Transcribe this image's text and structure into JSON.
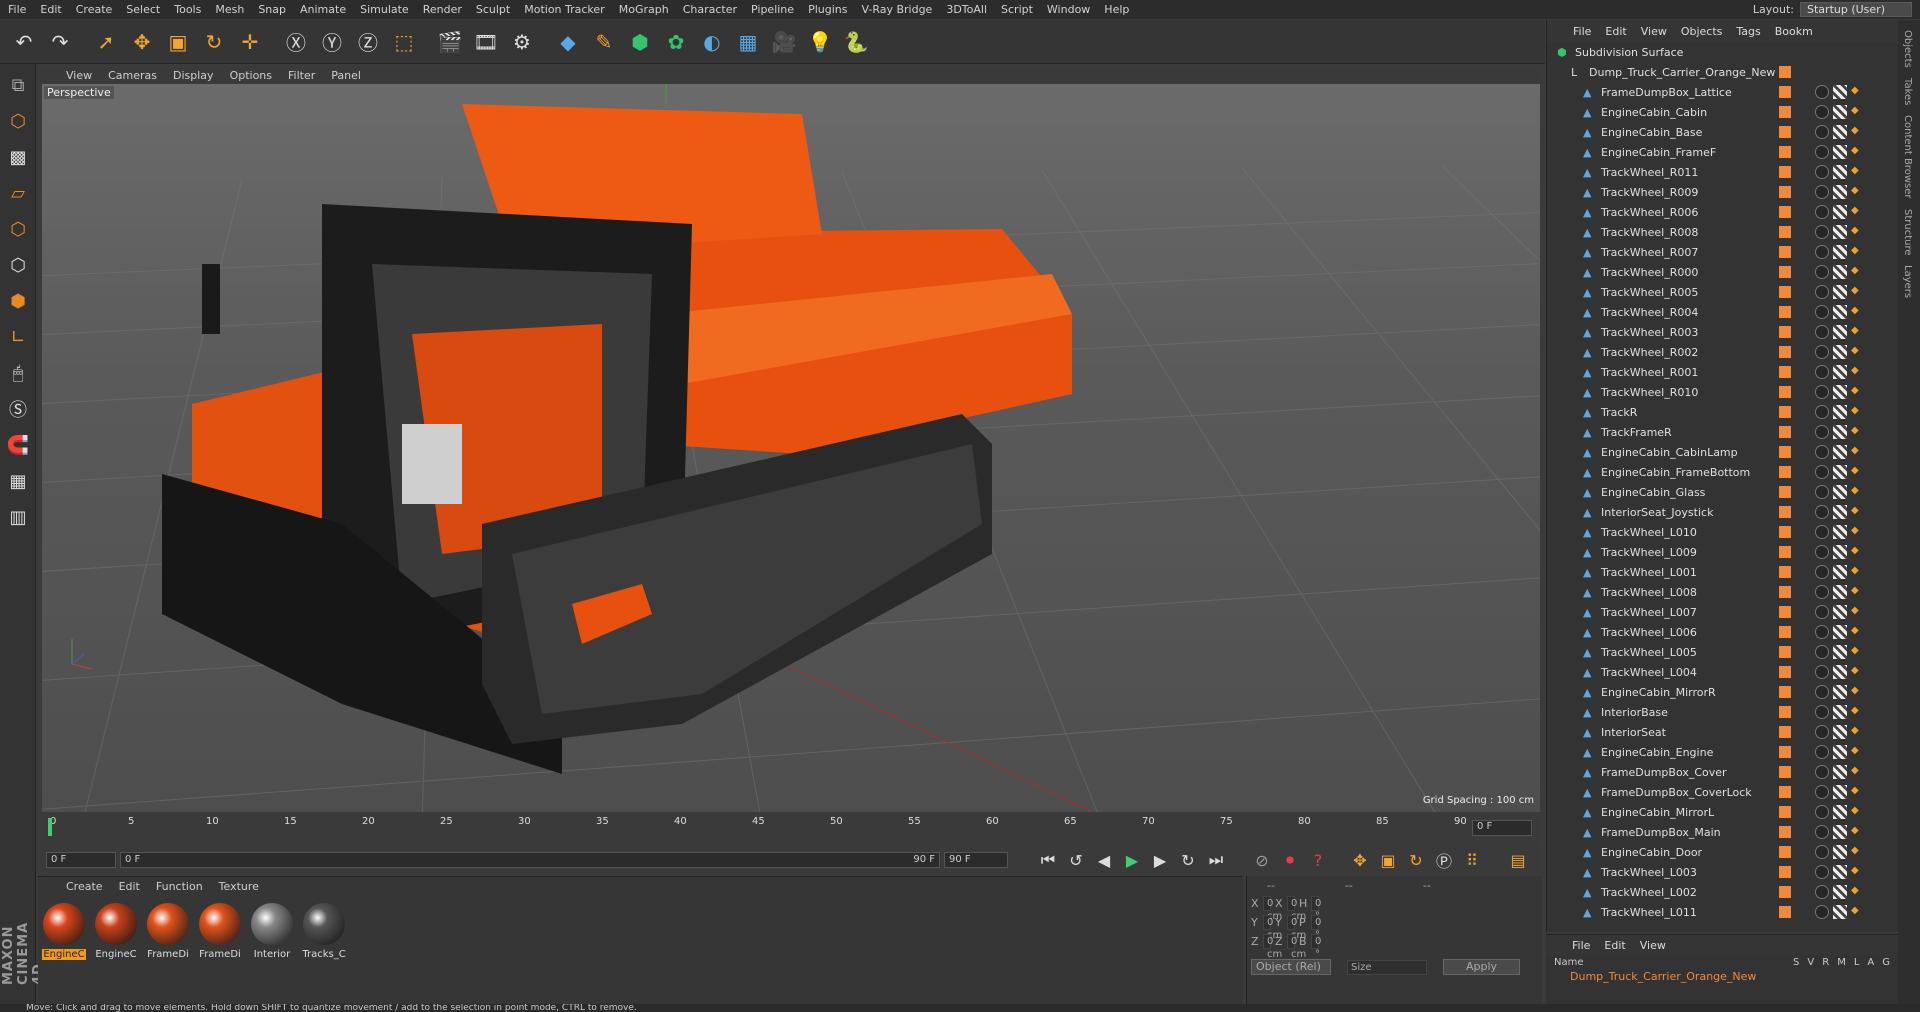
{
  "menu": [
    "File",
    "Edit",
    "Create",
    "Select",
    "Tools",
    "Mesh",
    "Snap",
    "Animate",
    "Simulate",
    "Render",
    "Sculpt",
    "Motion Tracker",
    "MoGraph",
    "Character",
    "Pipeline",
    "Plugins",
    "V-Ray Bridge",
    "3DToAll",
    "Script",
    "Window",
    "Help"
  ],
  "layout": {
    "label": "Layout:",
    "value": "Startup (User)"
  },
  "viewport": {
    "menu": [
      "View",
      "Cameras",
      "Display",
      "Options",
      "Filter",
      "Panel"
    ],
    "label": "Perspective",
    "grid_spacing": "Grid Spacing : 100 cm"
  },
  "timeline": {
    "ticks": [
      "0",
      "5",
      "10",
      "15",
      "20",
      "25",
      "30",
      "35",
      "40",
      "45",
      "50",
      "55",
      "60",
      "65",
      "70",
      "75",
      "80",
      "85",
      "90"
    ],
    "end_frame": "0 F"
  },
  "transport": {
    "start": "0 F",
    "range_start": "0 F",
    "range_end": "90 F",
    "end": "90 F"
  },
  "materials": {
    "menu": [
      "Create",
      "Edit",
      "Function",
      "Texture"
    ],
    "items": [
      {
        "label": "EngineC",
        "color": "#d8451a",
        "active": true
      },
      {
        "label": "EngineC",
        "color": "#c8401a",
        "active": false
      },
      {
        "label": "FrameDi",
        "color": "#e0521c",
        "active": false
      },
      {
        "label": "FrameDi",
        "color": "#e0521c",
        "active": false
      },
      {
        "label": "Interior",
        "color": "#888888",
        "active": false
      },
      {
        "label": "Tracks_C",
        "color": "#555555",
        "active": false
      }
    ]
  },
  "coords": {
    "header": [
      "--",
      "--",
      "--"
    ],
    "rows": [
      {
        "a": "X",
        "av": "0 cm",
        "b": "X",
        "bv": "0 cm",
        "c": "H",
        "cv": "0 °"
      },
      {
        "a": "Y",
        "av": "0 cm",
        "b": "Y",
        "bv": "0 cm",
        "c": "P",
        "cv": "0 °"
      },
      {
        "a": "Z",
        "av": "0 cm",
        "b": "Z",
        "bv": "0 cm",
        "c": "B",
        "cv": "0 °"
      }
    ],
    "mode": "Object (Rel)",
    "size": "Size",
    "apply": "Apply"
  },
  "objects": {
    "menu": [
      "File",
      "Edit",
      "View",
      "Objects",
      "Tags",
      "Bookm"
    ],
    "root": "Subdivision Surface",
    "group": "Dump_Truck_Carrier_Orange_New",
    "items": [
      "FrameDumpBox_Lattice",
      "EngineCabin_Cabin",
      "EngineCabin_Base",
      "EngineCabin_FrameF",
      "TrackWheel_R011",
      "TrackWheel_R009",
      "TrackWheel_R006",
      "TrackWheel_R008",
      "TrackWheel_R007",
      "TrackWheel_R000",
      "TrackWheel_R005",
      "TrackWheel_R004",
      "TrackWheel_R003",
      "TrackWheel_R002",
      "TrackWheel_R001",
      "TrackWheel_R010",
      "TrackR",
      "TrackFrameR",
      "EngineCabin_CabinLamp",
      "EngineCabin_FrameBottom",
      "EngineCabin_Glass",
      "InteriorSeat_Joystick",
      "TrackWheel_L010",
      "TrackWheel_L009",
      "TrackWheel_L001",
      "TrackWheel_L008",
      "TrackWheel_L007",
      "TrackWheel_L006",
      "TrackWheel_L005",
      "TrackWheel_L004",
      "EngineCabin_MirrorR",
      "InteriorBase",
      "InteriorSeat",
      "EngineCabin_Engine",
      "FrameDumpBox_Cover",
      "FrameDumpBox_CoverLock",
      "EngineCabin_MirrorL",
      "FrameDumpBox_Main",
      "EngineCabin_Door",
      "TrackWheel_L003",
      "TrackWheel_L002",
      "TrackWheel_L011"
    ]
  },
  "attributes": {
    "menu": [
      "File",
      "Edit",
      "View"
    ],
    "name_header": "Name",
    "cols": [
      "S",
      "V",
      "R",
      "M",
      "L",
      "A",
      "G"
    ],
    "row": "Dump_Truck_Carrier_Orange_New"
  },
  "side_tabs": [
    "Objects",
    "Takes",
    "Content Browser",
    "Structure",
    "Layers"
  ],
  "brand": "MAXON CINEMA 4D",
  "status": "Move: Click and drag to move elements. Hold down SHIFT to quantize movement / add to the selection in point mode, CTRL to remove."
}
